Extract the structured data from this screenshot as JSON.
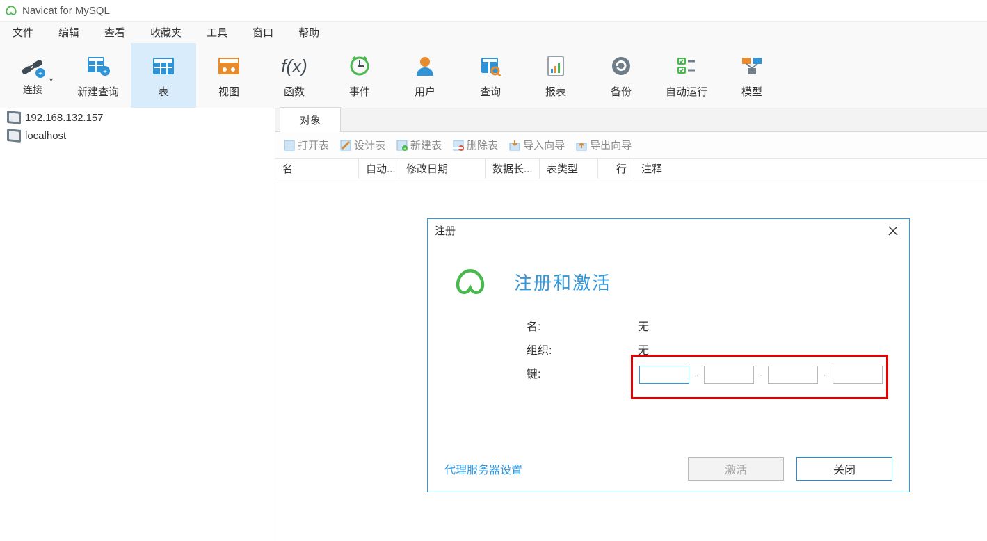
{
  "app": {
    "title": "Navicat for MySQL"
  },
  "menu": {
    "file": "文件",
    "edit": "编辑",
    "view": "查看",
    "favorites": "收藏夹",
    "tools": "工具",
    "window": "窗口",
    "help": "帮助"
  },
  "toolbar": {
    "connect": "连接",
    "new_query": "新建查询",
    "table": "表",
    "view": "视图",
    "function": "函数",
    "event": "事件",
    "user": "用户",
    "query": "查询",
    "report": "报表",
    "backup": "备份",
    "autorun": "自动运行",
    "model": "模型"
  },
  "sidebar": {
    "connections": [
      {
        "label": "192.168.132.157"
      },
      {
        "label": "localhost"
      }
    ]
  },
  "tabs": {
    "objects": "对象"
  },
  "sub_toolbar": {
    "open_table": "打开表",
    "design_table": "设计表",
    "new_table": "新建表",
    "delete_table": "删除表",
    "import_wizard": "导入向导",
    "export_wizard": "导出向导"
  },
  "columns": {
    "name": "名",
    "auto": "自动...",
    "modified": "修改日期",
    "data_len": "数据长...",
    "table_type": "表类型",
    "rows": "行",
    "comment": "注释"
  },
  "dialog": {
    "title": "注册",
    "heading": "注册和激活",
    "name_label": "名:",
    "name_value": "无",
    "org_label": "组织:",
    "org_value": "无",
    "key_label": "键:",
    "dash": "-",
    "proxy_link": "代理服务器设置",
    "activate_btn": "激活",
    "close_btn": "关闭"
  }
}
